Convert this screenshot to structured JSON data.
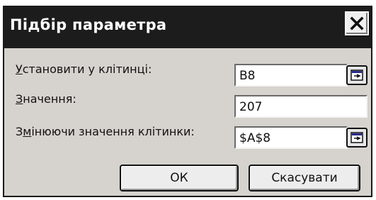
{
  "dialog": {
    "title": "Підбір параметра",
    "fields": [
      {
        "label": "Установити у клітинці:",
        "accel": "У",
        "value": "B8"
      },
      {
        "label": "Значення:",
        "accel": "З",
        "value": "207"
      },
      {
        "label": "Змінюючи значення клітинки:",
        "accel": "м",
        "value": "$A$8"
      }
    ],
    "ok_label": "ОК",
    "cancel_label": "Скасувати",
    "close_icon": "close-icon",
    "range_icon": "range-select-icon"
  }
}
